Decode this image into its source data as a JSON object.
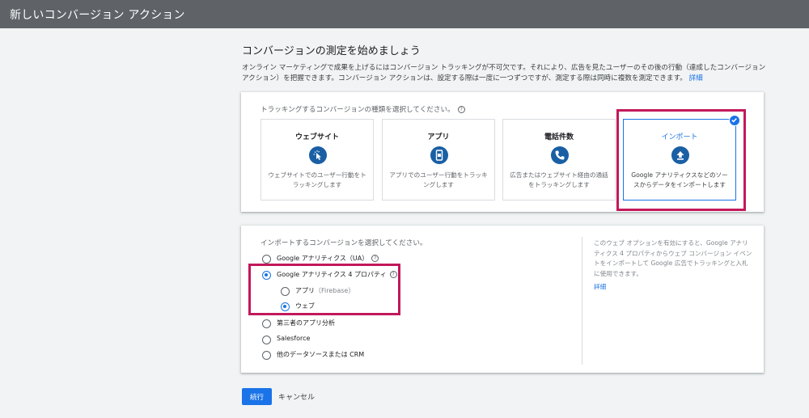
{
  "header": {
    "title": "新しいコンバージョン アクション"
  },
  "page": {
    "heading": "コンバージョンの測定を始めましょう",
    "intro": "オンライン マーケティングで成果を上げるにはコンバージョン トラッキングが不可欠です。それにより、広告を見たユーザーのその後の行動（達成したコンバージョン アクション）を把握できます。コンバージョン アクションは、設定する際は一度に一つずつですが、測定する際は同時に複数を測定できます。",
    "intro_link": "詳細"
  },
  "tracking": {
    "prompt": "トラッキングするコンバージョンの種類を選択してください。",
    "help_icon": "?",
    "tiles": [
      {
        "title": "ウェブサイト",
        "icon": "cursor-click-icon",
        "desc": "ウェブサイトでのユーザー行動をトラッキングします"
      },
      {
        "title": "アプリ",
        "icon": "mobile-phone-icon",
        "desc": "アプリでのユーザー行動をトラッキングします"
      },
      {
        "title": "電話件数",
        "icon": "phone-icon",
        "desc": "広告またはウェブサイト経由の通話をトラッキングします"
      },
      {
        "title": "インポート",
        "icon": "upload-icon",
        "desc": "Google アナリティクスなどのソースからデータをインポートします",
        "selected": true
      }
    ]
  },
  "import": {
    "prompt": "インポートするコンバージョンを選択してください。",
    "help_icon": "?",
    "options": [
      {
        "label": "Google アナリティクス（UA）",
        "selected": false
      },
      {
        "label": "Google アナリティクス 4 プロパティ",
        "selected": true
      },
      {
        "label": "アプリ",
        "sub": "（Firebase）",
        "selected": false
      },
      {
        "label": "ウェブ",
        "selected": true
      },
      {
        "label": "第三者のアプリ分析",
        "selected": false
      },
      {
        "label": "Salesforce",
        "selected": false
      },
      {
        "label": "他のデータソースまたは CRM",
        "selected": false
      }
    ],
    "side_text": "このウェブ オプションを有効にすると、Google アナリティクス 4 プロパティからウェブ コンバージョン イベントをインポートして Google 広告でトラッキングと入札に使用できます。",
    "side_link": "詳細"
  },
  "actions": {
    "continue_label": "続行",
    "cancel_label": "キャンセル"
  },
  "colors": {
    "accent": "#1a73e8",
    "highlight": "#c2185b",
    "topbar": "#5f6368",
    "icon_bg": "#1a5fa4"
  }
}
